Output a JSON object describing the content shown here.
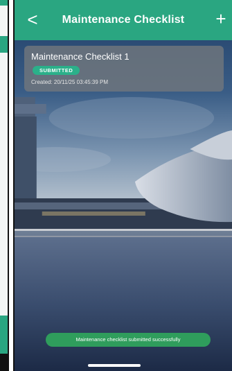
{
  "header": {
    "back_icon": "chevron-left-icon",
    "back_glyph": "<",
    "title": "Maintenance Checklist",
    "add_icon": "plus-icon",
    "add_glyph": "+"
  },
  "checklist": {
    "items": [
      {
        "title": "Maintenance Checklist 1",
        "status": "SUBMITTED",
        "created": "Created: 20/11/25 03:45:39 PM"
      }
    ]
  },
  "toast": {
    "message": "Maintenance checklist submitted successfully"
  },
  "colors": {
    "header": "#2aa681",
    "badge": "#2bb08a",
    "toast": "#2f9d5c",
    "card": "#70767c"
  }
}
